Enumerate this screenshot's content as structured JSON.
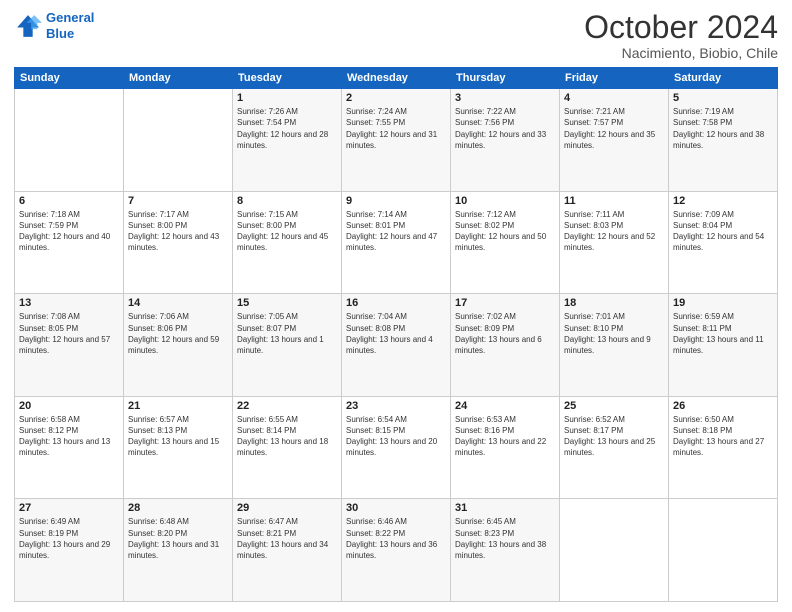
{
  "logo": {
    "line1": "General",
    "line2": "Blue"
  },
  "title": "October 2024",
  "subtitle": "Nacimiento, Biobio, Chile",
  "days_of_week": [
    "Sunday",
    "Monday",
    "Tuesday",
    "Wednesday",
    "Thursday",
    "Friday",
    "Saturday"
  ],
  "weeks": [
    [
      {
        "day": "",
        "info": ""
      },
      {
        "day": "",
        "info": ""
      },
      {
        "day": "1",
        "info": "Sunrise: 7:26 AM\nSunset: 7:54 PM\nDaylight: 12 hours and 28 minutes."
      },
      {
        "day": "2",
        "info": "Sunrise: 7:24 AM\nSunset: 7:55 PM\nDaylight: 12 hours and 31 minutes."
      },
      {
        "day": "3",
        "info": "Sunrise: 7:22 AM\nSunset: 7:56 PM\nDaylight: 12 hours and 33 minutes."
      },
      {
        "day": "4",
        "info": "Sunrise: 7:21 AM\nSunset: 7:57 PM\nDaylight: 12 hours and 35 minutes."
      },
      {
        "day": "5",
        "info": "Sunrise: 7:19 AM\nSunset: 7:58 PM\nDaylight: 12 hours and 38 minutes."
      }
    ],
    [
      {
        "day": "6",
        "info": "Sunrise: 7:18 AM\nSunset: 7:59 PM\nDaylight: 12 hours and 40 minutes."
      },
      {
        "day": "7",
        "info": "Sunrise: 7:17 AM\nSunset: 8:00 PM\nDaylight: 12 hours and 43 minutes."
      },
      {
        "day": "8",
        "info": "Sunrise: 7:15 AM\nSunset: 8:00 PM\nDaylight: 12 hours and 45 minutes."
      },
      {
        "day": "9",
        "info": "Sunrise: 7:14 AM\nSunset: 8:01 PM\nDaylight: 12 hours and 47 minutes."
      },
      {
        "day": "10",
        "info": "Sunrise: 7:12 AM\nSunset: 8:02 PM\nDaylight: 12 hours and 50 minutes."
      },
      {
        "day": "11",
        "info": "Sunrise: 7:11 AM\nSunset: 8:03 PM\nDaylight: 12 hours and 52 minutes."
      },
      {
        "day": "12",
        "info": "Sunrise: 7:09 AM\nSunset: 8:04 PM\nDaylight: 12 hours and 54 minutes."
      }
    ],
    [
      {
        "day": "13",
        "info": "Sunrise: 7:08 AM\nSunset: 8:05 PM\nDaylight: 12 hours and 57 minutes."
      },
      {
        "day": "14",
        "info": "Sunrise: 7:06 AM\nSunset: 8:06 PM\nDaylight: 12 hours and 59 minutes."
      },
      {
        "day": "15",
        "info": "Sunrise: 7:05 AM\nSunset: 8:07 PM\nDaylight: 13 hours and 1 minute."
      },
      {
        "day": "16",
        "info": "Sunrise: 7:04 AM\nSunset: 8:08 PM\nDaylight: 13 hours and 4 minutes."
      },
      {
        "day": "17",
        "info": "Sunrise: 7:02 AM\nSunset: 8:09 PM\nDaylight: 13 hours and 6 minutes."
      },
      {
        "day": "18",
        "info": "Sunrise: 7:01 AM\nSunset: 8:10 PM\nDaylight: 13 hours and 9 minutes."
      },
      {
        "day": "19",
        "info": "Sunrise: 6:59 AM\nSunset: 8:11 PM\nDaylight: 13 hours and 11 minutes."
      }
    ],
    [
      {
        "day": "20",
        "info": "Sunrise: 6:58 AM\nSunset: 8:12 PM\nDaylight: 13 hours and 13 minutes."
      },
      {
        "day": "21",
        "info": "Sunrise: 6:57 AM\nSunset: 8:13 PM\nDaylight: 13 hours and 15 minutes."
      },
      {
        "day": "22",
        "info": "Sunrise: 6:55 AM\nSunset: 8:14 PM\nDaylight: 13 hours and 18 minutes."
      },
      {
        "day": "23",
        "info": "Sunrise: 6:54 AM\nSunset: 8:15 PM\nDaylight: 13 hours and 20 minutes."
      },
      {
        "day": "24",
        "info": "Sunrise: 6:53 AM\nSunset: 8:16 PM\nDaylight: 13 hours and 22 minutes."
      },
      {
        "day": "25",
        "info": "Sunrise: 6:52 AM\nSunset: 8:17 PM\nDaylight: 13 hours and 25 minutes."
      },
      {
        "day": "26",
        "info": "Sunrise: 6:50 AM\nSunset: 8:18 PM\nDaylight: 13 hours and 27 minutes."
      }
    ],
    [
      {
        "day": "27",
        "info": "Sunrise: 6:49 AM\nSunset: 8:19 PM\nDaylight: 13 hours and 29 minutes."
      },
      {
        "day": "28",
        "info": "Sunrise: 6:48 AM\nSunset: 8:20 PM\nDaylight: 13 hours and 31 minutes."
      },
      {
        "day": "29",
        "info": "Sunrise: 6:47 AM\nSunset: 8:21 PM\nDaylight: 13 hours and 34 minutes."
      },
      {
        "day": "30",
        "info": "Sunrise: 6:46 AM\nSunset: 8:22 PM\nDaylight: 13 hours and 36 minutes."
      },
      {
        "day": "31",
        "info": "Sunrise: 6:45 AM\nSunset: 8:23 PM\nDaylight: 13 hours and 38 minutes."
      },
      {
        "day": "",
        "info": ""
      },
      {
        "day": "",
        "info": ""
      }
    ]
  ]
}
